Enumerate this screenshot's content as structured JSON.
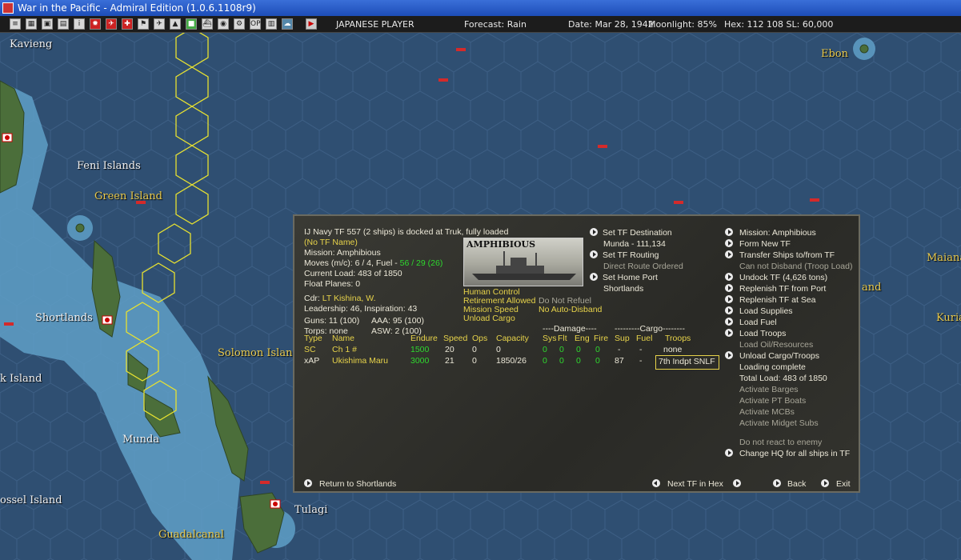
{
  "window_title": "War in the Pacific - Admiral Edition (1.0.6.1108r9)",
  "status": {
    "player": "JAPANESE PLAYER",
    "forecast": "Forecast: Rain",
    "date": "Date: Mar 28, 1942",
    "moonlight": "Moonlight: 85%",
    "hex": "Hex: 112 108  SL: 60,000"
  },
  "map_labels": {
    "kavieng": "Kavieng",
    "feni": "Feni Islands",
    "green": "Green Island",
    "shortlands": "Shortlands",
    "solomon": "Solomon Islan",
    "k_island": "k Island",
    "munda": "Munda",
    "ossel": "ossel Island",
    "tulagi": "Tulagi",
    "guadalcanal": "Guadalcanal",
    "ebon": "Ebon",
    "maiana": "Maiana",
    "and": "and",
    "kuria": "Kuria"
  },
  "tf": {
    "header": "IJ Navy TF 557 (2 ships) is docked at Truk, fully loaded",
    "name": "(No TF Name)",
    "mission": "Mission: Amphibious",
    "moves": "Moves (m/c): 6 / 4, Fuel - ",
    "fuel": "56 / 29 (26)",
    "load": "Current Load: 483 of 1850",
    "float_planes": "Float Planes: 0",
    "cdr_label": "Cdr:",
    "cdr": "LT  Kishina, W.",
    "leadership": "Leadership: 46, Inspiration: 43",
    "guns": "Guns: 11 (100)",
    "aaa": "AAA: 95 (100)",
    "torps": "Torps: none",
    "asw": "ASW: 2 (100)",
    "photo_label": "AMPHIBIOUS",
    "flags": {
      "human_control": "Human Control",
      "retirement": "Retirement Allowed",
      "no_refuel": "Do Not Refuel",
      "mission_speed": "Mission Speed",
      "no_disband": "No Auto-Disband",
      "unload": "Unload Cargo"
    },
    "center_actions": {
      "dest": "Set TF Destination",
      "dest_value": "Munda - 111,134",
      "routing": "Set TF Routing",
      "routing_value": "Direct Route Ordered",
      "home": "Set Home Port",
      "home_value": "Shortlands"
    }
  },
  "table": {
    "group_damage": "----Damage----",
    "group_cargo": "---------Cargo--------",
    "headers": [
      "Type",
      "Name",
      "Endure",
      "Speed",
      "Ops",
      "Capacity",
      "Sys",
      "Flt",
      "Eng",
      "Fire",
      "Sup",
      "Fuel",
      "Troops"
    ],
    "rows": [
      [
        "SC",
        "Ch 1 #",
        "1500",
        "20",
        "0",
        "0",
        "0",
        "0",
        "0",
        "0",
        "-",
        "-",
        "none"
      ],
      [
        "xAP",
        "Ukishima Maru",
        "3000",
        "21",
        "0",
        "1850/26",
        "0",
        "0",
        "0",
        "0",
        "87",
        "-",
        "7th Indpt SNLF"
      ]
    ]
  },
  "right_menu": {
    "mission": "Mission: Amphibious",
    "form_new": "Form New TF",
    "transfer": "Transfer Ships to/from TF",
    "no_disband": "Can not Disband (Troop Load)",
    "undock": "Undock TF (4,626 tons)",
    "replenish_port": "Replenish TF from Port",
    "replenish_sea": "Replenish TF at Sea",
    "load_supplies": "Load Supplies",
    "load_fuel": "Load Fuel",
    "load_troops": "Load Troops",
    "load_oil": "Load Oil/Resources",
    "unload": "Unload Cargo/Troops",
    "loading_complete": "Loading complete",
    "total_load": "Total Load: 483 of 1850",
    "barges": "Activate Barges",
    "pt_boats": "Activate PT Boats",
    "mcbs": "Activate MCBs",
    "midget": "Activate Midget Subs",
    "no_react": "Do not react to enemy",
    "change_hq": "Change HQ for all ships in TF"
  },
  "bottom": {
    "return": "Return to Shortlands",
    "next_tf": "Next TF in Hex",
    "back": "Back",
    "exit": "Exit"
  },
  "colors": {
    "sea": "#2f4f72",
    "shallow": "#5f9fc7",
    "land": "#4b6e3a",
    "route": "#e8e230",
    "panel": "#2f2f2a",
    "text_yellow": "#e7d34a",
    "text_green": "#2ed82e"
  }
}
